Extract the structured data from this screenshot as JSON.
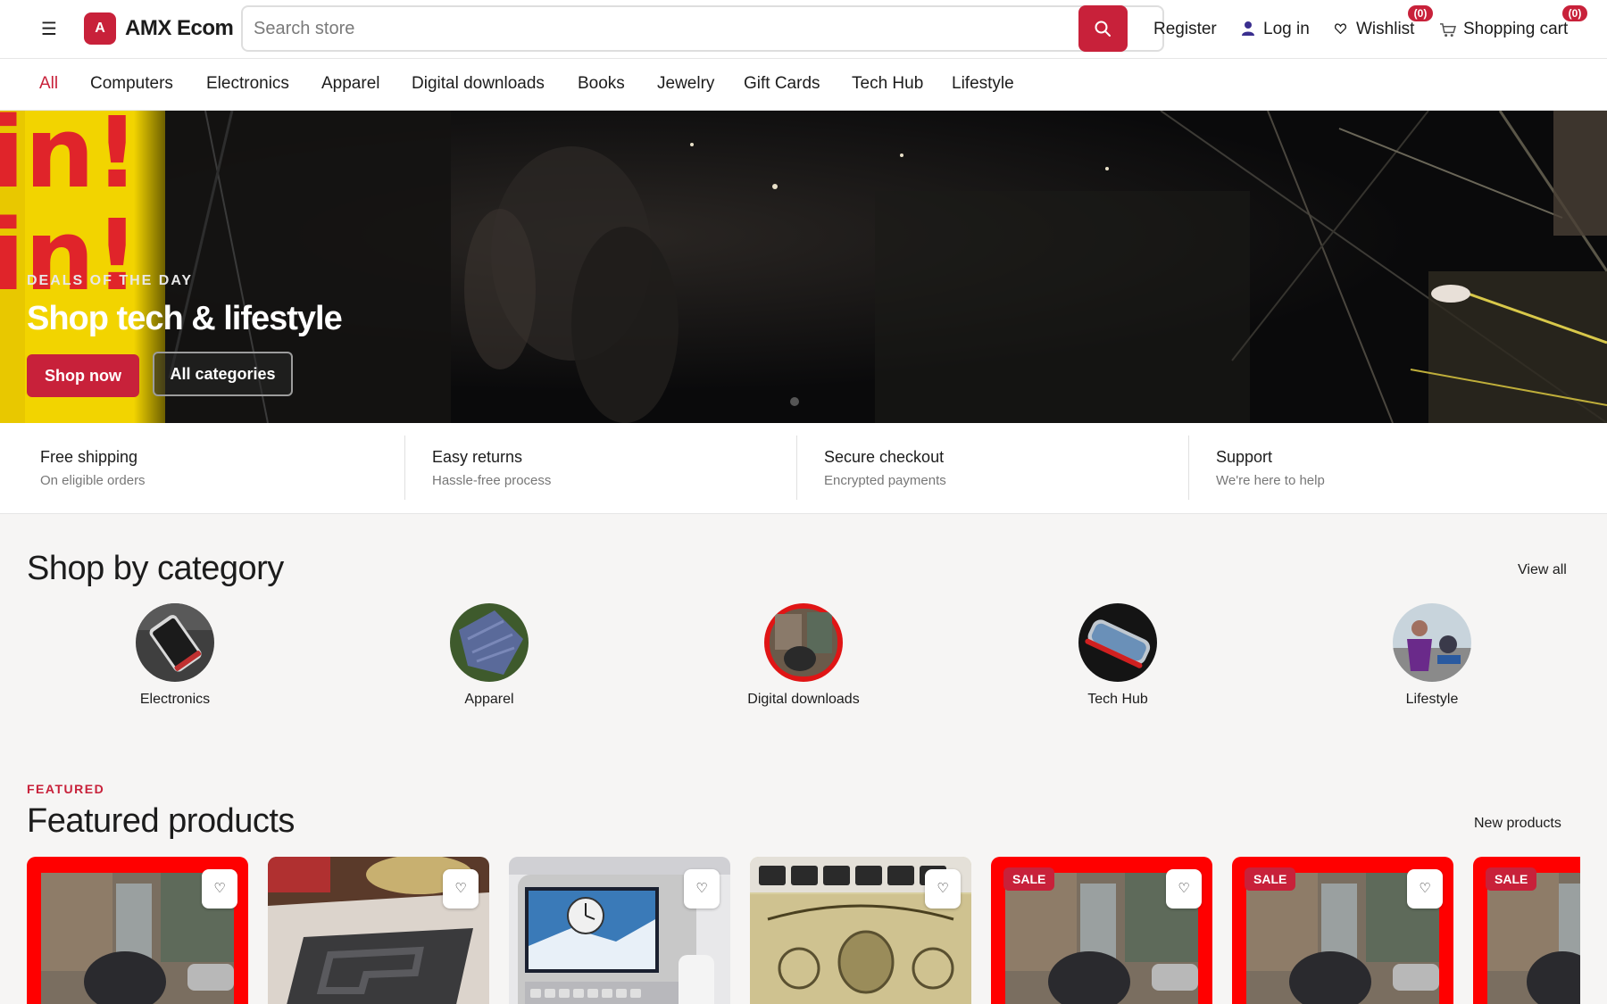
{
  "header": {
    "menu_glyph": "☰",
    "logo_mark": "A",
    "logo_text": "AMX Ecom",
    "search_placeholder": "Search store",
    "register_label": "Register",
    "login_label": "Log in",
    "wishlist_label": "Wishlist",
    "wishlist_count": "(0)",
    "cart_label": "Shopping cart",
    "cart_count": "(0)"
  },
  "categories_nav": [
    "All",
    "Computers",
    "Electronics",
    "Apparel",
    "Digital downloads",
    "Books",
    "Jewelry",
    "Gift Cards",
    "Tech Hub",
    "Lifestyle"
  ],
  "hero": {
    "eyebrow": "DEALS OF THE DAY",
    "title": "Shop tech & lifestyle",
    "primary_button": "Shop now",
    "secondary_button": "All categories",
    "banner_lettering": "in! in!"
  },
  "features": [
    {
      "title": "Free shipping",
      "subtitle": "On eligible orders"
    },
    {
      "title": "Easy returns",
      "subtitle": "Hassle-free process"
    },
    {
      "title": "Secure checkout",
      "subtitle": "Encrypted payments"
    },
    {
      "title": "Support",
      "subtitle": "We're here to help"
    }
  ],
  "shop_by_category": {
    "title": "Shop by category",
    "view_all": "View all",
    "items": [
      "Electronics",
      "Apparel",
      "Digital downloads",
      "Tech Hub",
      "Lifestyle"
    ]
  },
  "featured": {
    "eyebrow": "FEATURED",
    "title": "Featured products",
    "link": "New products",
    "sale_label": "SALE"
  },
  "colors": {
    "accent": "#c8213a",
    "page_background": "#f6f5f4"
  },
  "icons": [
    "menu-icon",
    "search-icon",
    "user-icon",
    "heart-icon",
    "cart-icon"
  ]
}
